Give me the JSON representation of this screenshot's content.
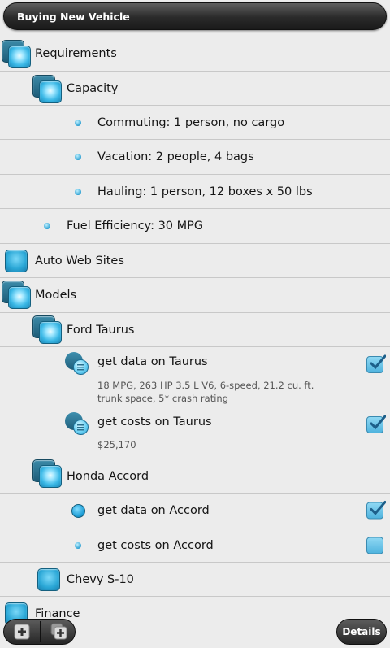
{
  "header": {
    "title": "Buying New Vehicle"
  },
  "rows": [
    {
      "label": "Requirements",
      "icon": "folder-open-icon"
    },
    {
      "label": "Capacity",
      "icon": "folder-open-icon"
    },
    {
      "label": "Commuting: 1 person, no cargo",
      "icon": "bullet-icon"
    },
    {
      "label": "Vacation: 2 people, 4 bags",
      "icon": "bullet-icon"
    },
    {
      "label": "Hauling: 1 person, 12 boxes x 50 lbs",
      "icon": "bullet-icon"
    },
    {
      "label": "Fuel Efficiency: 30 MPG",
      "icon": "bullet-icon"
    },
    {
      "label": "Auto Web Sites",
      "icon": "folder-closed-icon"
    },
    {
      "label": "Models",
      "icon": "folder-open-icon"
    },
    {
      "label": "Ford Taurus",
      "icon": "folder-open-icon"
    },
    {
      "label": "get data on Taurus",
      "note": "18 MPG, 263 HP 3.5 L V6, 6-speed, 21.2 cu. ft. trunk space, 5* crash rating",
      "icon": "note-icon",
      "checked": true
    },
    {
      "label": "get costs on Taurus",
      "note": "$25,170",
      "icon": "note-icon",
      "checked": true
    },
    {
      "label": "Honda Accord",
      "icon": "folder-open-icon"
    },
    {
      "label": "get data on Accord",
      "icon": "task-dot-icon",
      "checked": true
    },
    {
      "label": "get costs on Accord",
      "icon": "bullet-icon",
      "checked": false
    },
    {
      "label": "Chevy S-10",
      "icon": "folder-closed-icon"
    },
    {
      "label": "Finance",
      "icon": "folder-closed-icon"
    }
  ],
  "toolbar": {
    "add_icon": "add-icon",
    "add_child_icon": "add-child-icon",
    "details_label": "Details"
  },
  "colors": {
    "accent": "#2aa7d6",
    "header": "#2a2a2a",
    "background": "#ececec"
  }
}
